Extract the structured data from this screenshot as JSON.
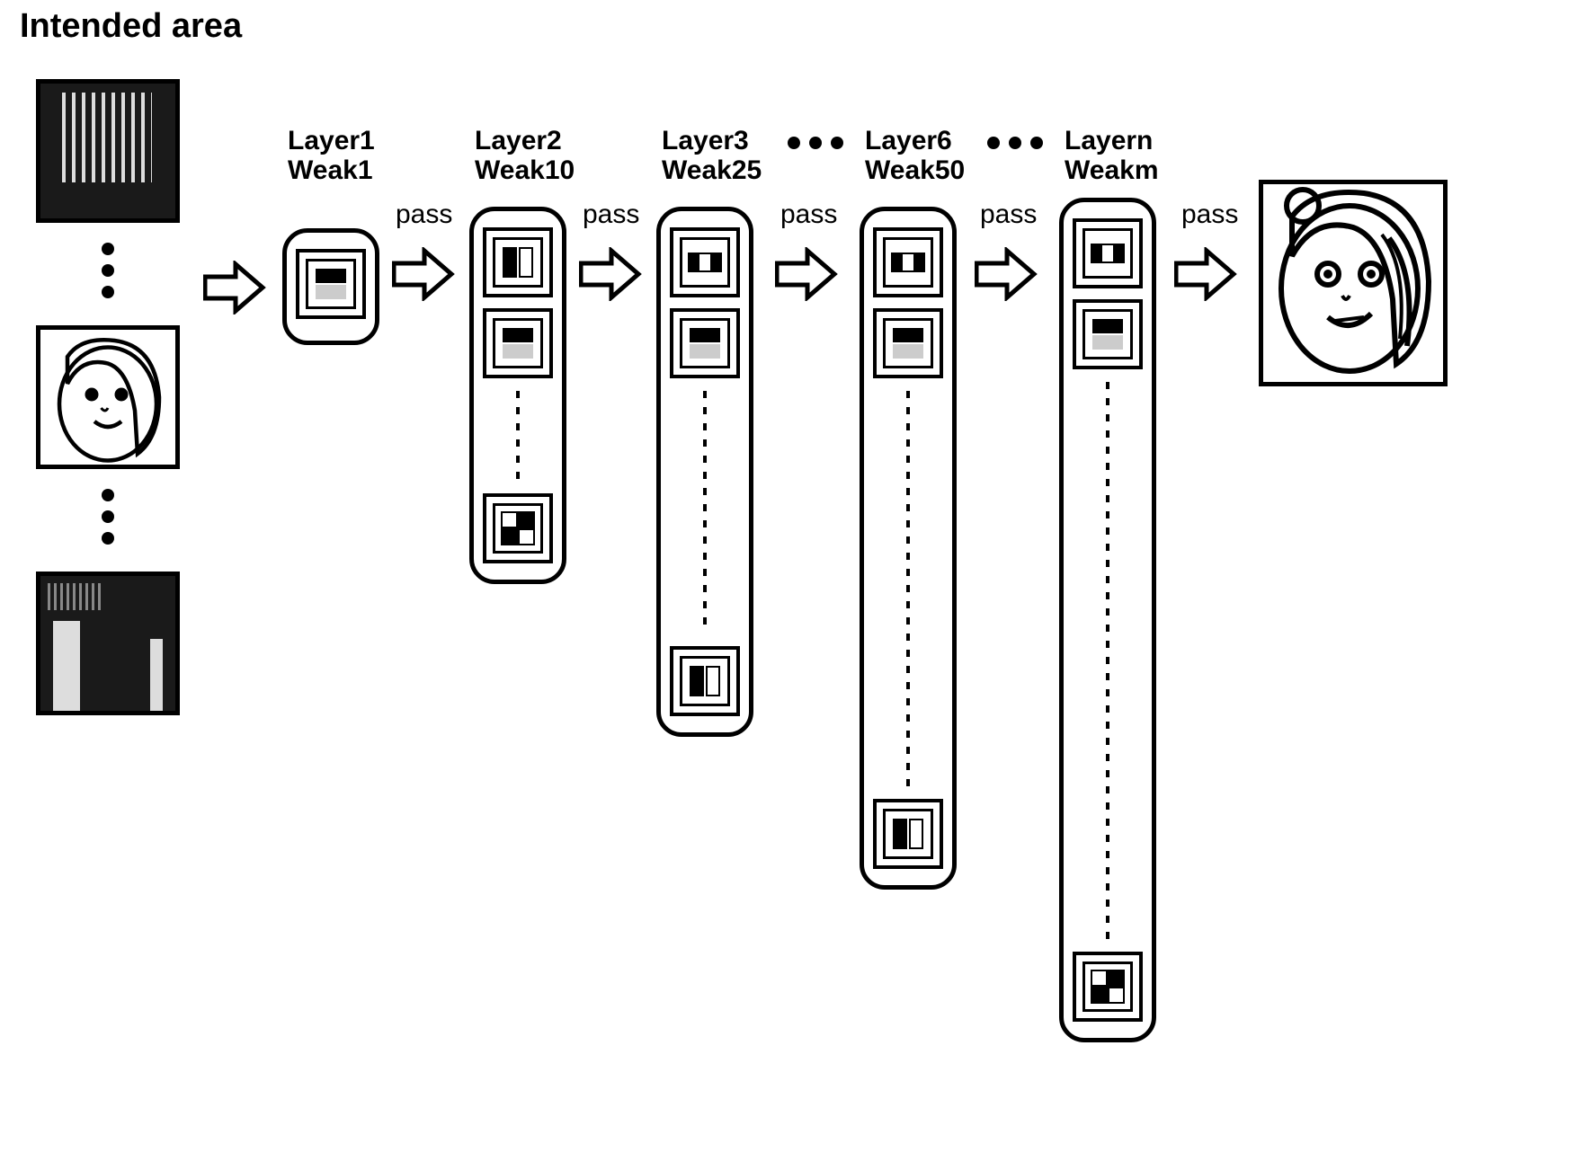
{
  "title": "Intended area",
  "layers": [
    {
      "name": "Layer1",
      "weak": "Weak1"
    },
    {
      "name": "Layer2",
      "weak": "Weak10"
    },
    {
      "name": "Layer3",
      "weak": "Weak25"
    },
    {
      "name": "Layer6",
      "weak": "Weak50"
    },
    {
      "name": "Layern",
      "weak": "Weakm"
    }
  ],
  "pass_label": "pass",
  "ellipsis": "• • •"
}
